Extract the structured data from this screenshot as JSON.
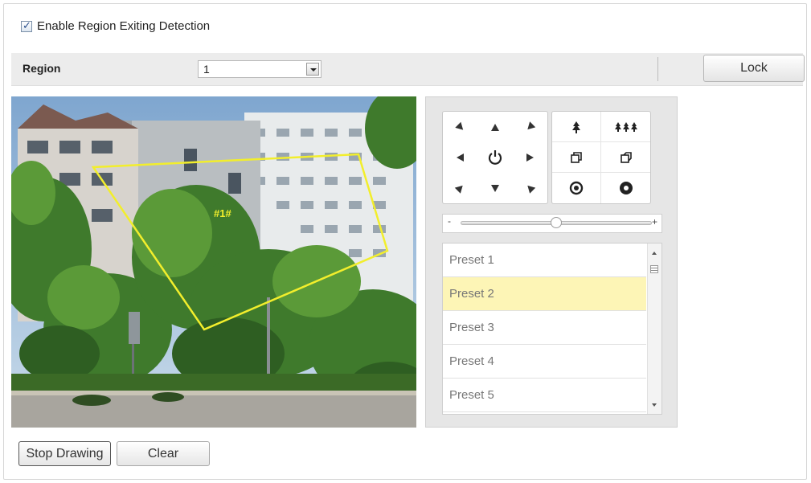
{
  "settings": {
    "enable_label": "Enable Region Exiting Detection",
    "enable_checked": true
  },
  "region": {
    "label": "Region",
    "selected": "1",
    "lock_label": "Lock"
  },
  "video": {
    "region_tag": "#1#",
    "outline_color": "#f2ee2c"
  },
  "ptz": {
    "direction_icons": [
      "arrow-up-left-icon",
      "arrow-up-icon",
      "arrow-up-right-icon",
      "arrow-left-icon",
      "auto-rotate-icon",
      "arrow-right-icon",
      "arrow-down-left-icon",
      "arrow-down-icon",
      "arrow-down-right-icon"
    ],
    "function_icons": [
      "zoom-in-icon",
      "zoom-out-icon",
      "focus-near-icon",
      "focus-far-icon",
      "iris-open-icon",
      "iris-close-icon"
    ],
    "speed_minus": "-",
    "speed_plus": "+",
    "speed_level": 0.5,
    "presets": [
      "Preset 1",
      "Preset 2",
      "Preset 3",
      "Preset 4",
      "Preset 5"
    ],
    "selected_preset": "Preset 2"
  },
  "buttons": {
    "stop_drawing": "Stop Drawing",
    "clear": "Clear"
  }
}
